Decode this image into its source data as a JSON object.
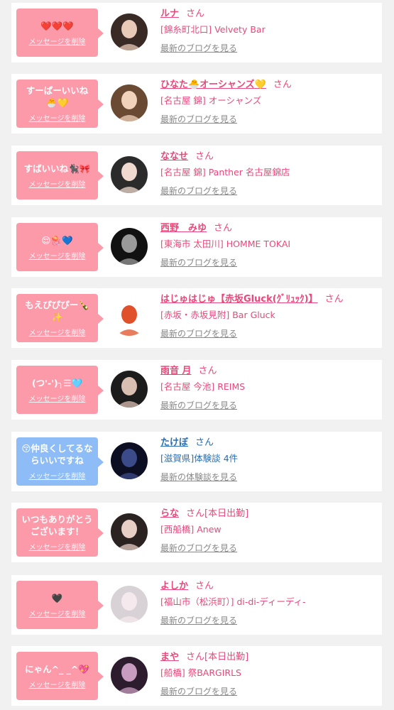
{
  "delete_label": "メッセージを削除",
  "colors": {
    "pink": "#fc9aaa",
    "blue": "#8ebcf6",
    "name_pink": "#e8487a",
    "name_blue": "#2a6db0"
  },
  "items": [
    {
      "message": "❤️❤️❤️",
      "name": "ルナ",
      "san": "さん",
      "extra": "",
      "store": "[錦糸町北口] Velvety Bar",
      "link": "最新のブログを見る",
      "theme": "pink",
      "avatar_icon": "girl-avatar"
    },
    {
      "message": "すーぱーいいね🐣💛",
      "name": "ひなた🐣オーシャンズ💛",
      "san": "さん",
      "extra": "",
      "store": "[名古屋 錦] オーシャンズ",
      "link": "最新のブログを見る",
      "theme": "pink",
      "avatar_icon": "girl-avatar"
    },
    {
      "message": "すばいいね🐈‍⬛🎀",
      "name": "ななせ",
      "san": "さん",
      "extra": "",
      "store": "[名古屋 錦] Panther 名古屋錦店",
      "link": "最新のブログを見る",
      "theme": "pink",
      "avatar_icon": "girl-avatar"
    },
    {
      "message": "😌🪼💙",
      "name": "西野　みゆ",
      "san": "さん",
      "extra": "",
      "store": "[東海市 太田川] HOMME TOKAI",
      "link": "最新のブログを見る",
      "theme": "pink",
      "avatar_icon": "logo-avatar"
    },
    {
      "message": "もえぴぴぴー🍾✨",
      "name": "はじゅはじゅ【赤坂Gluck(ｸﾞﾘｭｯｸ)】",
      "san": "さん",
      "extra": "",
      "store": "[赤坂・赤坂見附] Bar Gluck",
      "link": "最新のブログを見る",
      "theme": "pink",
      "avatar_icon": "illustration-avatar"
    },
    {
      "message": "(つ'-')╮☰🩵",
      "name": "雨音 月",
      "san": "さん",
      "extra": "",
      "store": "[名古屋 今池] REIMS",
      "link": "最新のブログを見る",
      "theme": "pink",
      "avatar_icon": "girl-avatar"
    },
    {
      "message": "😚仲良くしてるならいいですね",
      "name": "たけぼ",
      "san": "さん",
      "extra": "",
      "store": "[滋賀県]体験談 4件",
      "link": "最新の体験談を見る",
      "theme": "blue",
      "avatar_icon": "night-avatar"
    },
    {
      "message": "いつもありがとうございます！",
      "name": "らな",
      "san": "さん",
      "extra": "[本日出勤]",
      "store": "[西船橋] Anew",
      "link": "最新のブログを見る",
      "theme": "pink",
      "avatar_icon": "girl-avatar"
    },
    {
      "message": "🖤",
      "name": "よしか",
      "san": "さん",
      "extra": "",
      "store": "[福山市（松浜町）] di-di-ディーディ-",
      "link": "最新のブログを見る",
      "theme": "pink",
      "avatar_icon": "girl-avatar"
    },
    {
      "message": "にゃん^_ _^💖",
      "name": "まや",
      "san": "さん",
      "extra": "[本日出勤]",
      "store": "[船橋] 祭BARGIRLS",
      "link": "最新のブログを見る",
      "theme": "pink",
      "avatar_icon": "girl-avatar"
    }
  ]
}
